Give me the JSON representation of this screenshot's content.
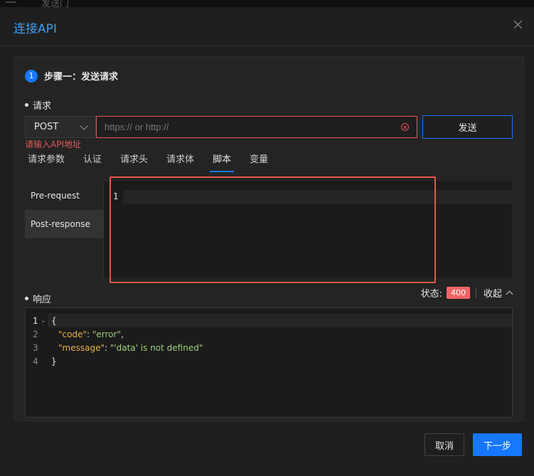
{
  "background": {
    "ghost_text": "发送门"
  },
  "modal": {
    "title": "连接API"
  },
  "step": {
    "number": "1",
    "title": "步骤一：发送请求"
  },
  "request": {
    "section_label": "请求",
    "method": "POST",
    "url_placeholder": "https:// or http://",
    "url_value": "",
    "send_label": "发送",
    "error": "请输入API地址",
    "tabs": [
      {
        "label": "请求参数",
        "active": false
      },
      {
        "label": "认证",
        "active": false
      },
      {
        "label": "请求头",
        "active": false
      },
      {
        "label": "请求体",
        "active": false
      },
      {
        "label": "脚本",
        "active": true
      },
      {
        "label": "变量",
        "active": false
      }
    ],
    "script_nav": [
      {
        "label": "Pre-request",
        "active": false
      },
      {
        "label": "Post-response",
        "active": true
      }
    ],
    "editor": {
      "line_numbers": [
        "1"
      ],
      "content": ""
    }
  },
  "response": {
    "section_label": "响应",
    "status_label": "状态:",
    "status_code": "400",
    "collapse_label": "收起",
    "lines": [
      {
        "num": "1",
        "brace": "{"
      },
      {
        "num": "2",
        "key": "\"code\"",
        "colon": ": ",
        "value": "\"error\"",
        "tail": ","
      },
      {
        "num": "3",
        "key": "\"message\"",
        "colon": ": ",
        "value": "\"'data' is not defined\"",
        "tail": ""
      },
      {
        "num": "4",
        "brace": "}"
      }
    ]
  },
  "footer": {
    "cancel_label": "取消",
    "next_label": "下一步"
  },
  "colors": {
    "accent": "#1677ff",
    "error": "#e2585a",
    "status_badge": "#f26565",
    "highlight": "#e05a47"
  }
}
